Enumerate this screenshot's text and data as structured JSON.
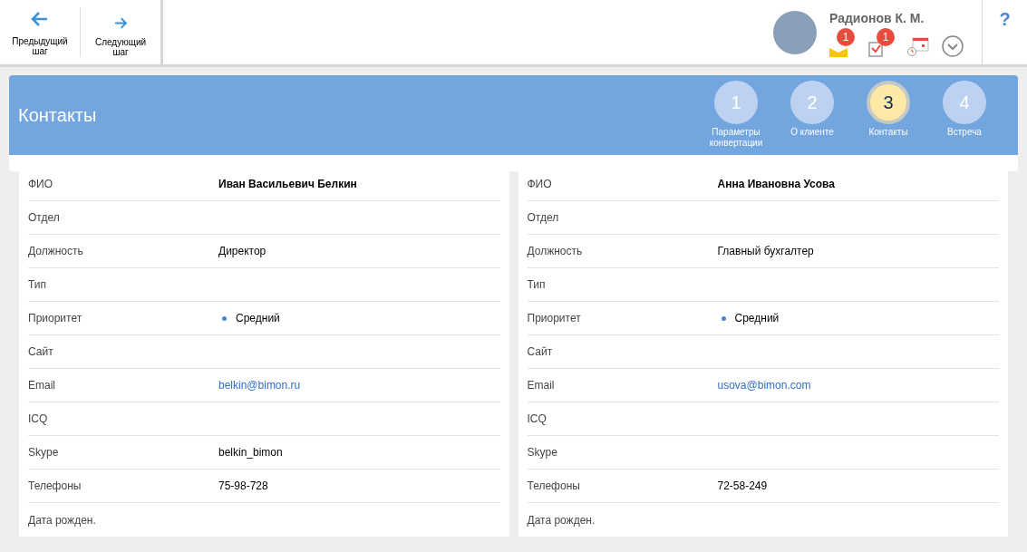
{
  "toolbar": {
    "buttons": [
      {
        "kind": "prev",
        "label": "Предыдущий шаг"
      },
      {
        "kind": "next",
        "label": "Следующий шаг"
      }
    ]
  },
  "user": {
    "name": "Радионов К. М.",
    "mail_count": "1",
    "tasks_count": "1",
    "help": "?"
  },
  "header": {
    "title": "Контакты",
    "steps": [
      {
        "number": "1",
        "label": "Параметры конвертации",
        "selected": false
      },
      {
        "number": "2",
        "label": "О клиенте",
        "selected": false
      },
      {
        "number": "3",
        "label": "Контакты",
        "selected": true
      },
      {
        "number": "4",
        "label": "Встреча",
        "selected": false
      }
    ]
  },
  "contacts": [
    {
      "fields": [
        {
          "label": "ФИО",
          "value": "Иван Васильевич Белкин",
          "kind": "bold"
        },
        {
          "label": "Отдел"
        },
        {
          "label": "Должность",
          "value": "Директор",
          "kind": "text"
        },
        {
          "label": "Тип"
        },
        {
          "label": "Приоритет",
          "value": "Средний",
          "kind": "priority",
          "color": "#4a86d0"
        },
        {
          "label": "Сайт"
        },
        {
          "label": "Email",
          "value": "belkin@bimon.ru",
          "kind": "link"
        },
        {
          "label": "ICQ"
        },
        {
          "label": "Skype",
          "value": "belkin_bimon",
          "kind": "text"
        },
        {
          "label": "Телефоны",
          "value": "75-98-728",
          "kind": "text"
        },
        {
          "label": "Дата рожден."
        }
      ]
    },
    {
      "fields": [
        {
          "label": "ФИО",
          "value": "Анна Ивановна Усова",
          "kind": "bold"
        },
        {
          "label": "Отдел"
        },
        {
          "label": "Должность",
          "value": "Главный бухгалтер",
          "kind": "text"
        },
        {
          "label": "Тип"
        },
        {
          "label": "Приоритет",
          "value": "Средний",
          "kind": "priority",
          "color": "#4a86d0"
        },
        {
          "label": "Сайт"
        },
        {
          "label": "Email",
          "value": "usova@bimon.com",
          "kind": "link"
        },
        {
          "label": "ICQ"
        },
        {
          "label": "Skype"
        },
        {
          "label": "Телефоны",
          "value": "72-58-249",
          "kind": "text"
        },
        {
          "label": "Дата рожден."
        }
      ]
    }
  ]
}
